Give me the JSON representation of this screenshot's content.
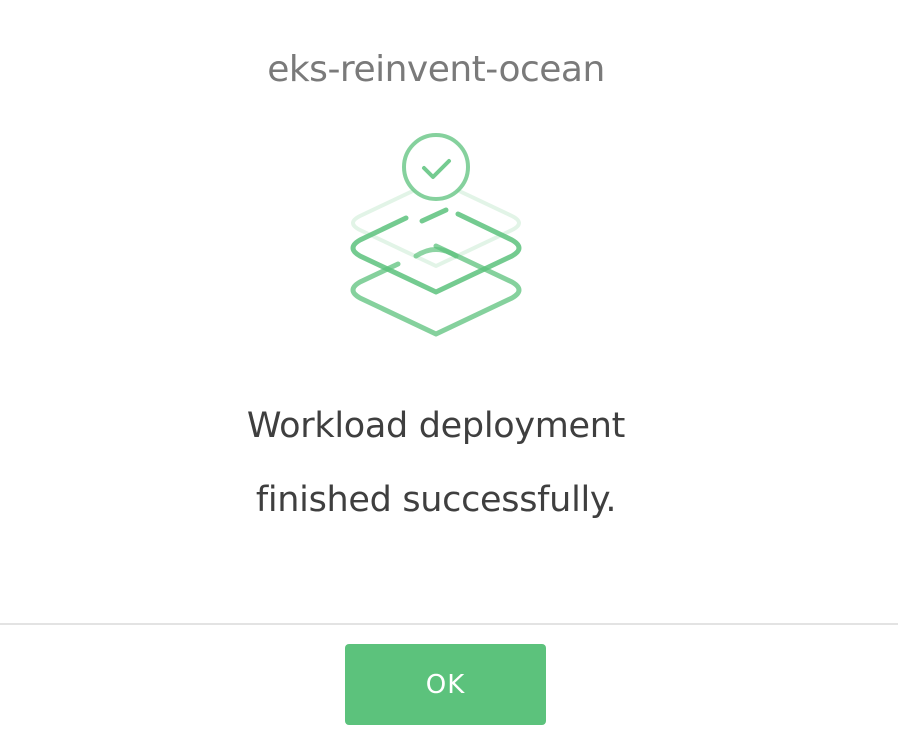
{
  "dialog": {
    "title": "eks-reinvent-ocean",
    "message_line1": "Workload deployment",
    "message_line2": "finished successfully.",
    "ok_label": "OK",
    "illustration": "layered-stack-success-icon"
  },
  "colors": {
    "accent_green": "#5cc27c",
    "title_gray": "#7a7a7a",
    "message_dark": "#3f3f3f",
    "divider": "#e3e3e3"
  }
}
